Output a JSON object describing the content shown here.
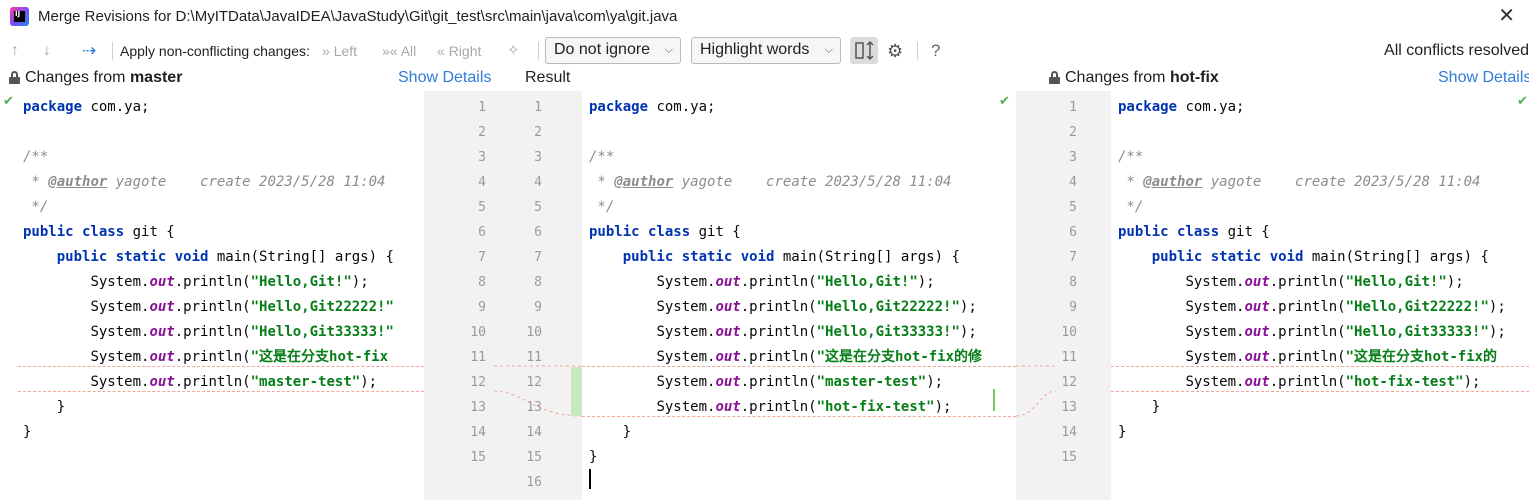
{
  "window": {
    "title": "Merge Revisions for D:\\MyITData\\JavaIDEA\\JavaStudy\\Git\\git_test\\src\\main\\java\\com\\ya\\git.java",
    "close_icon": "close-icon"
  },
  "toolbar": {
    "apply_label": "Apply non-conflicting changes:",
    "left_label": "Left",
    "all_label": "All",
    "right_label": "Right",
    "whitespace_select": "Do not ignore",
    "highlight_select": "Highlight words",
    "help_label": "?",
    "status": "All conflicts resolved"
  },
  "panes": {
    "left": {
      "label_prefix": "Changes from ",
      "label_branch": "master",
      "show_details": "Show Details"
    },
    "center": {
      "label": "Result"
    },
    "right": {
      "label_prefix": "Changes from ",
      "label_branch": "hot-fix",
      "show_details": "Show Details"
    }
  },
  "line_numbers": {
    "left": [
      "1",
      "2",
      "3",
      "4",
      "5",
      "6",
      "7",
      "8",
      "9",
      "10",
      "11",
      "12",
      "13",
      "14",
      "15"
    ],
    "result": [
      "1",
      "2",
      "3",
      "4",
      "5",
      "6",
      "7",
      "8",
      "9",
      "10",
      "11",
      "12",
      "13",
      "14",
      "15",
      "16"
    ],
    "right": [
      "1",
      "2",
      "3",
      "4",
      "5",
      "6",
      "7",
      "8",
      "9",
      "10",
      "11",
      "12",
      "13",
      "14",
      "15"
    ]
  },
  "code": {
    "left": [
      {
        "kw": "package",
        "rest": " com.ya;"
      },
      {
        "plain": ""
      },
      {
        "cm": "/**"
      },
      {
        "cm_pre": " * ",
        "tag": "@author",
        "cm_post": " yagote    create 2023/5/28 11:04"
      },
      {
        "cm": " */"
      },
      {
        "kw": "public class",
        "rest": " git {"
      },
      {
        "indent": "    ",
        "kw": "public static void",
        "rest": " main(String[] args) {"
      },
      {
        "indent": "        ",
        "pre": "System.",
        "fld": "out",
        "mid": ".println(",
        "str": "\"Hello,Git!\"",
        "post": ");"
      },
      {
        "indent": "        ",
        "pre": "System.",
        "fld": "out",
        "mid": ".println(",
        "str": "\"Hello,Git22222!\"",
        "post": ""
      },
      {
        "indent": "        ",
        "pre": "System.",
        "fld": "out",
        "mid": ".println(",
        "str": "\"Hello,Git33333!\"",
        "post": ""
      },
      {
        "indent": "        ",
        "pre": "System.",
        "fld": "out",
        "mid": ".println(",
        "str": "\"这是在分支hot-fix",
        "post": ""
      },
      {
        "indent": "        ",
        "pre": "System.",
        "fld": "out",
        "mid": ".println(",
        "str": "\"master-test\"",
        "post": ");"
      },
      {
        "plain": "    }"
      },
      {
        "plain": "}"
      }
    ],
    "result": [
      {
        "kw": "package",
        "rest": " com.ya;"
      },
      {
        "plain": ""
      },
      {
        "cm": "/**"
      },
      {
        "cm_pre": " * ",
        "tag": "@author",
        "cm_post": " yagote    create 2023/5/28 11:04"
      },
      {
        "cm": " */"
      },
      {
        "kw": "public class",
        "rest": " git {"
      },
      {
        "indent": "    ",
        "kw": "public static void",
        "rest": " main(String[] args) {"
      },
      {
        "indent": "        ",
        "pre": "System.",
        "fld": "out",
        "mid": ".println(",
        "str": "\"Hello,Git!\"",
        "post": ");"
      },
      {
        "indent": "        ",
        "pre": "System.",
        "fld": "out",
        "mid": ".println(",
        "str": "\"Hello,Git22222!\"",
        "post": ");"
      },
      {
        "indent": "        ",
        "pre": "System.",
        "fld": "out",
        "mid": ".println(",
        "str": "\"Hello,Git33333!\"",
        "post": ");"
      },
      {
        "indent": "        ",
        "pre": "System.",
        "fld": "out",
        "mid": ".println(",
        "str": "\"这是在分支hot-fix的修",
        "post": ""
      },
      {
        "indent": "        ",
        "pre": "System.",
        "fld": "out",
        "mid": ".println(",
        "str": "\"master-test\"",
        "post": ");"
      },
      {
        "indent": "        ",
        "pre": "System.",
        "fld": "out",
        "mid": ".println(",
        "str": "\"hot-fix-test\"",
        "post": ");"
      },
      {
        "plain": "    }"
      },
      {
        "plain": "}"
      },
      {
        "plain": ""
      }
    ],
    "right": [
      {
        "kw": "package",
        "rest": " com.ya;"
      },
      {
        "plain": ""
      },
      {
        "cm": "/**"
      },
      {
        "cm_pre": " * ",
        "tag": "@author",
        "cm_post": " yagote    create 2023/5/28 11:04"
      },
      {
        "cm": " */"
      },
      {
        "kw": "public class",
        "rest": " git {"
      },
      {
        "indent": "    ",
        "kw": "public static void",
        "rest": " main(String[] args) {"
      },
      {
        "indent": "        ",
        "pre": "System.",
        "fld": "out",
        "mid": ".println(",
        "str": "\"Hello,Git!\"",
        "post": ");"
      },
      {
        "indent": "        ",
        "pre": "System.",
        "fld": "out",
        "mid": ".println(",
        "str": "\"Hello,Git22222!\"",
        "post": ");"
      },
      {
        "indent": "        ",
        "pre": "System.",
        "fld": "out",
        "mid": ".println(",
        "str": "\"Hello,Git33333!\"",
        "post": ");"
      },
      {
        "indent": "        ",
        "pre": "System.",
        "fld": "out",
        "mid": ".println(",
        "str": "\"这是在分支hot-fix的",
        "post": ""
      },
      {
        "indent": "        ",
        "pre": "System.",
        "fld": "out",
        "mid": ".println(",
        "str": "\"hot-fix-test\"",
        "post": ");"
      },
      {
        "plain": "    }"
      },
      {
        "plain": "}"
      }
    ]
  },
  "colors": {
    "keyword": "#0033b3",
    "string": "#067d17",
    "field": "#871094",
    "comment": "#8c8c8c",
    "link": "#2f7bd8",
    "resolved_check": "#4caf50"
  }
}
